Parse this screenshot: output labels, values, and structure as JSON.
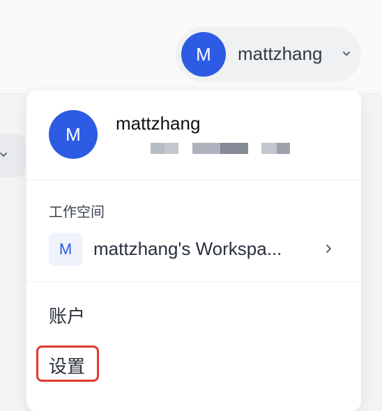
{
  "header": {
    "user": {
      "initial": "M",
      "name": "mattzhang"
    }
  },
  "dropdown": {
    "user": {
      "initial": "M",
      "name": "mattzhang"
    },
    "workspace_section_label": "工作空间",
    "workspace": {
      "initial": "M",
      "name": "mattzhang's Workspa..."
    },
    "menu": {
      "account": "账户",
      "settings": "设置"
    }
  },
  "colors": {
    "accent": "#2d5be3",
    "highlight": "#e0382c"
  },
  "icons": {
    "pill_chevron": "chevron-down-icon",
    "workspace_chevron": "chevron-right-icon"
  }
}
